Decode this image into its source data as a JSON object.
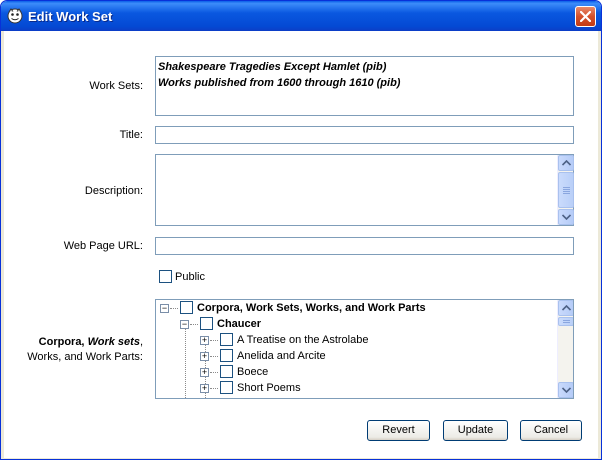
{
  "window": {
    "title": "Edit Work Set"
  },
  "form": {
    "worksets_label": "Work Sets:",
    "worksets": [
      "Shakespeare Tragedies Except Hamlet (pib)",
      "Works published from 1600 through 1610 (pib)"
    ],
    "title_label": "Title:",
    "title_value": "",
    "description_label": "Description:",
    "description_value": "",
    "url_label": "Web Page URL:",
    "url_value": "",
    "public_label": "Public",
    "public_checked": false,
    "tree_label_part1": "Corpora, ",
    "tree_label_part2": "Work sets",
    "tree_label_part3": ",",
    "tree_label_line2": "Works, and Work Parts:"
  },
  "tree": {
    "root": "Corpora, Work Sets, Works, and Work Parts",
    "corpus": "Chaucer",
    "items": [
      "A Treatise on the Astrolabe",
      "Anelida and Arcite",
      "Boece",
      "Short Poems"
    ]
  },
  "buttons": {
    "revert": "Revert",
    "update": "Update",
    "cancel": "Cancel"
  }
}
